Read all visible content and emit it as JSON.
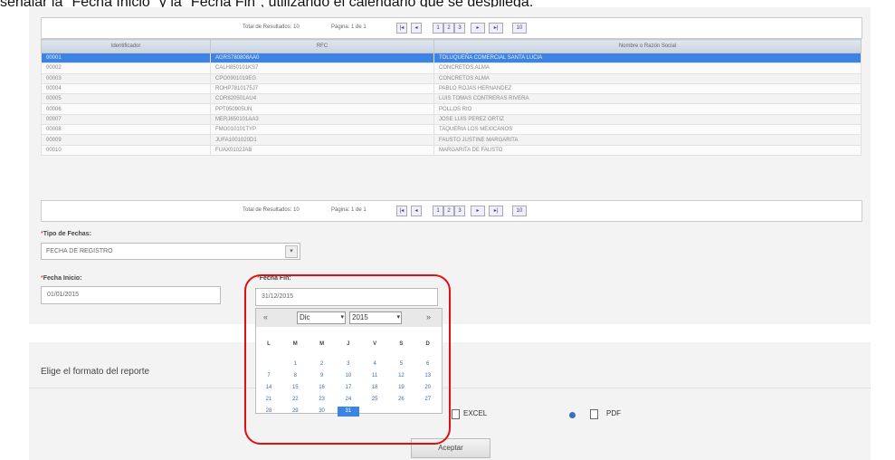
{
  "caption": "señalar la \"Fecha Inicio\" y la \"Fecha Fin\", utilizando el calendario que se despliega.",
  "pager": {
    "total_label": "Total de Resultados: 10",
    "page_label": "Página: 1 de 1",
    "first": "|◂",
    "prev": "◂",
    "pages": [
      "1",
      "2",
      "3"
    ],
    "next": "▸",
    "last": "▸|",
    "per_page": "10"
  },
  "grid": {
    "columns": [
      "Identificador",
      "RFC",
      "Nombre o Razón Social"
    ],
    "rows": [
      [
        "00001",
        "AGRS780808AA0",
        "TOLUQUEÑA COMERCIAL SANTA LUCIA"
      ],
      [
        "00002",
        "CALH850101KS7",
        "CONCRETOS ALMA"
      ],
      [
        "00003",
        "CPO0901019EG",
        "CONCRETOS ALMA"
      ],
      [
        "00004",
        "ROHP7810175J7",
        "PABLO ROJAS HERNANDEZ"
      ],
      [
        "00005",
        "COR820501AU4",
        "LUIS TOMAS CONTRERAS RIVERA"
      ],
      [
        "00006",
        "PPT050905UN",
        "POLLOS RIO"
      ],
      [
        "00007",
        "MERJ650101AA3",
        "JOSE LUIS PEREZ ORTIZ"
      ],
      [
        "00008",
        "FMO010101TYP",
        "TAQUERIA LOS MEXICANOS"
      ],
      [
        "00009",
        "JUFA1001020D1",
        "FAUSTO JUSTINE MARGARITA"
      ],
      [
        "00010",
        "FUAX0102JAB",
        "MARGARITA DE FAUSTO"
      ]
    ],
    "selected_row": 0
  },
  "tipo_fecha": {
    "label": "Tipo de Fechas:",
    "required_mark": "*",
    "value": "FECHA DE REGISTRO"
  },
  "fecha_inicio": {
    "label": "Fecha Inicio:",
    "required_mark": "*",
    "value": "01/01/2015"
  },
  "fecha_fin": {
    "label": "Fecha Fin:",
    "required_mark": "*",
    "value": "31/12/2015"
  },
  "calendar": {
    "prev": "«",
    "next": "»",
    "month": "Dic",
    "year": "2015",
    "weekdays": [
      "L",
      "M",
      "M",
      "J",
      "V",
      "S",
      "D"
    ],
    "weeks": [
      [
        "",
        "1",
        "2",
        "3",
        "4",
        "5",
        "6"
      ],
      [
        "7",
        "8",
        "9",
        "10",
        "11",
        "12",
        "13"
      ],
      [
        "14",
        "15",
        "16",
        "17",
        "18",
        "19",
        "20"
      ],
      [
        "21",
        "22",
        "23",
        "24",
        "25",
        "26",
        "27"
      ],
      [
        "28",
        "29",
        "30",
        "31",
        "",
        "",
        ""
      ]
    ],
    "selected_day": "31"
  },
  "report": {
    "heading": "Elige el formato del reporte",
    "excel_label": "EXCEL",
    "pdf_label": "PDF",
    "accept_label": "Aceptar"
  },
  "colors": {
    "accent": "#3b84e6",
    "highlight_ring": "#e01010"
  }
}
